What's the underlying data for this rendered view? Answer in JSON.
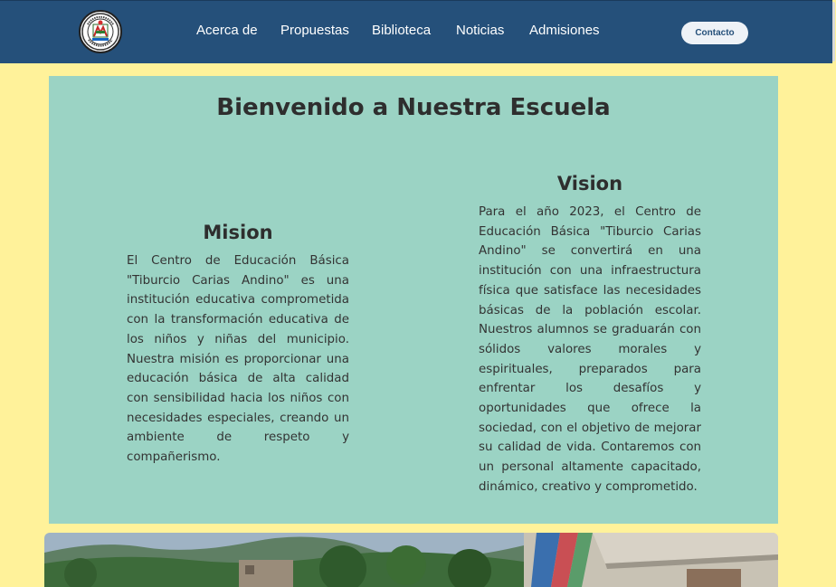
{
  "header": {
    "logo": "school-crest-logo",
    "nav": [
      {
        "label": "Acerca de"
      },
      {
        "label": "Propuestas"
      },
      {
        "label": "Biblioteca"
      },
      {
        "label": "Noticias"
      },
      {
        "label": "Admisiones"
      }
    ],
    "contact_label": "Contacto"
  },
  "hero": {
    "title": "Bienvenido a Nuestra Escuela",
    "mission": {
      "title": "Mision",
      "text": "El Centro de Educación Básica \"Tiburcio Carias Andino\" es una institución educativa comprometida con la transformación educativa de los niños y niñas del municipio. Nuestra misión es proporcionar una educación básica de alta calidad con sensibilidad hacia los niños con necesidades especiales, creando un ambiente de respeto y compañerismo."
    },
    "vision": {
      "title": "Vision",
      "text": "Para el año 2023, el Centro de Educación Básica \"Tiburcio Carias Andino\" se convertirá en una institución con una infraestructura física que satisface las necesidades básicas de la población escolar. Nuestros alumnos se graduarán con sólidos valores morales y espirituales, preparados para enfrentar los desafíos y oportunidades que ofrece la sociedad, con el objetivo de mejorar su calidad de vida. Contaremos con un personal altamente capacitado, dinámico, creativo y comprometido."
    }
  },
  "colors": {
    "header_bg": "#25507a",
    "page_bg": "#fff29a",
    "hero_bg": "#9bd3c4"
  }
}
